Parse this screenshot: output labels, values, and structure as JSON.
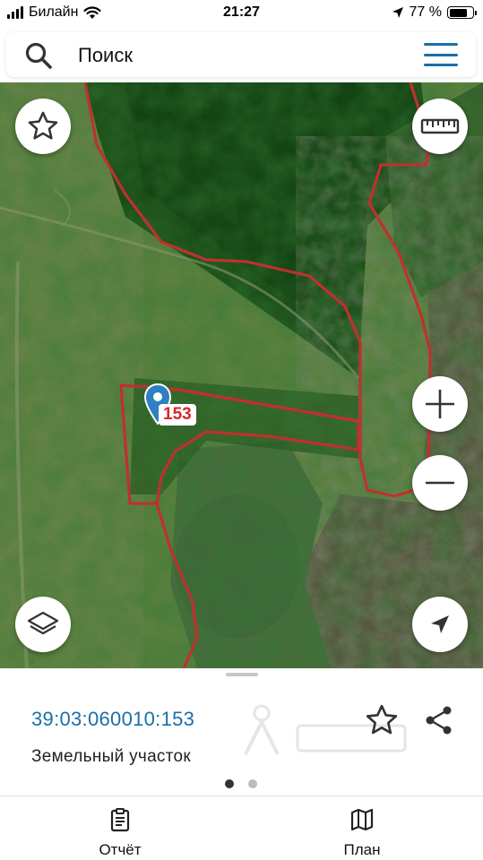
{
  "status_bar": {
    "carrier": "Билайн",
    "time": "21:27",
    "battery": "77 %",
    "battery_level": 0.77
  },
  "search": {
    "placeholder": "Поиск",
    "icon": "search-icon",
    "menu_icon": "hamburger-menu-icon"
  },
  "map": {
    "controls": [
      "star-icon",
      "ruler-icon",
      "zoom-in-icon",
      "zoom-out-icon",
      "layers-icon",
      "locate-arrow-icon"
    ],
    "parcel_label": "153",
    "boundary_color": "#c0302f",
    "pin_color": "#2f7fc1"
  },
  "sheet": {
    "cadastral_number": "39:03:060010:153",
    "object_type": "Земельный участок",
    "star_icon": "star-outline-icon",
    "share_icon": "share-icon",
    "pages": 2,
    "active_page": 1
  },
  "tabbar": {
    "report_label": "Отчёт",
    "plan_label": "План"
  }
}
